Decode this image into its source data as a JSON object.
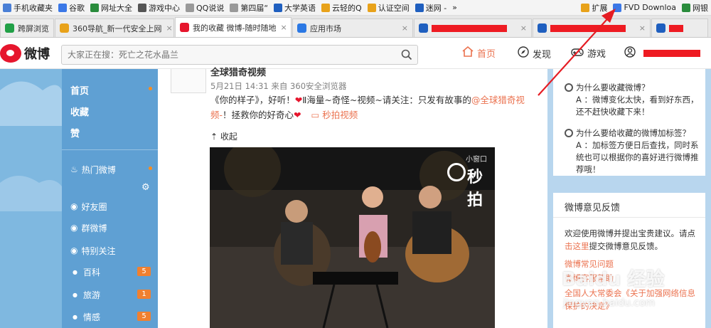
{
  "bookmarks": [
    {
      "label": "手机收藏夹",
      "icon": "phone-icon",
      "color": "#4a7fd6"
    },
    {
      "label": "谷歌",
      "icon": "google-icon",
      "color": "#3b78e7"
    },
    {
      "label": "网址大全",
      "icon": "home-icon",
      "color": "#2a8c3c"
    },
    {
      "label": "游戏中心",
      "icon": "gamepad-icon",
      "color": "#555555"
    },
    {
      "label": "QQ说说",
      "icon": "page-icon",
      "color": "#999999"
    },
    {
      "label": "第四届“",
      "icon": "page-icon",
      "color": "#999999"
    },
    {
      "label": "大学英语",
      "icon": "paw-icon",
      "color": "#1f5fbf"
    },
    {
      "label": "云轻的Q",
      "icon": "star-icon",
      "color": "#e8a21a"
    },
    {
      "label": "认证空间",
      "icon": "star-icon",
      "color": "#e8a21a"
    },
    {
      "label": "迷网 -",
      "icon": "paw-icon",
      "color": "#1f5fbf"
    }
  ],
  "bookmarks_more": "»",
  "extensions": {
    "label": "扩展",
    "download": "FVD Downloa",
    "bank": "网银"
  },
  "tabs": [
    {
      "label": "跨屏浏览",
      "active": false,
      "icon": "cross-screen-icon",
      "color": "#21a047",
      "close": ""
    },
    {
      "label": "360导航_新一代安全上网",
      "active": false,
      "icon": "360-icon",
      "color": "#e8a21a",
      "close": "×"
    },
    {
      "label": "我的收藏 微博-随时随地",
      "active": true,
      "icon": "weibo-icon",
      "color": "#e6162d",
      "close": "×"
    },
    {
      "label": "应用市场",
      "active": false,
      "icon": "apps-icon",
      "color": "#2b78e4",
      "close": "×"
    },
    {
      "label": "",
      "active": false,
      "icon": "paw-icon",
      "color": "#1f5fbf",
      "close": "×",
      "redacted": true
    },
    {
      "label": "",
      "active": false,
      "icon": "paw-icon",
      "color": "#1f5fbf",
      "close": "×",
      "redacted": true
    },
    {
      "label": "",
      "active": false,
      "icon": "paw-icon",
      "color": "#1f5fbf",
      "close": "",
      "redacted": true
    }
  ],
  "header": {
    "logo": "微博",
    "search_placeholder": "大家正在搜：死亡之花水晶兰",
    "nav_home": "首页",
    "nav_discover": "发现",
    "nav_game": "游戏"
  },
  "left_nav": {
    "home": "首页",
    "favorites": "收藏",
    "likes": "赞",
    "hot": "热门微博",
    "friends": "好友圈",
    "groups": "群微博",
    "special": "特别关注",
    "categories": [
      {
        "label": "百科",
        "count": "5"
      },
      {
        "label": "旅游",
        "count": "1"
      },
      {
        "label": "情感",
        "count": "5"
      }
    ]
  },
  "post": {
    "author": "全球猎奇视频",
    "meta": "5月21日 14:31 来自 360安全浏览器",
    "text_1": "《你的样子》，好听！",
    "text_2": "海量~奇怪~视频~请关注：只发有故事的",
    "mention": "@全球猎奇视频-",
    "text_3": "！拯救你的好奇心",
    "video_link": "秒拍视频",
    "collapse": "收起",
    "video_logo": "秒拍",
    "mini_window": "小窗口"
  },
  "faq": [
    {
      "q": "为什么要收藏微博？",
      "a": "A ：微博变化太快，看到好东西，还不赶快收藏下来！"
    },
    {
      "q": "为什么要给收藏的微博加标签？",
      "a": "A ：加标签方便日后查找，同时系统也可以根据你的喜好进行微博推荐哦！"
    }
  ],
  "feedback": {
    "title": "微博意见反馈",
    "intro_1": "欢迎使用微博并提出宝贵建议。请点",
    "link": "击这里",
    "intro_2": "提交微博意见反馈。",
    "item1": "微博常见问题",
    "item2": "微博客服帮助",
    "item3": "全国人大常委会《关于加强网络信息保护的决定》"
  },
  "watermark": {
    "brand": "Baidu 经验",
    "url": "jingyan.baidu.com"
  },
  "colors": {
    "weibo_red": "#e6162d",
    "orange": "#eb7350",
    "badge": "#f08030",
    "sidebar": "#7fb8e0",
    "right_bg": "#b8d6ee"
  }
}
